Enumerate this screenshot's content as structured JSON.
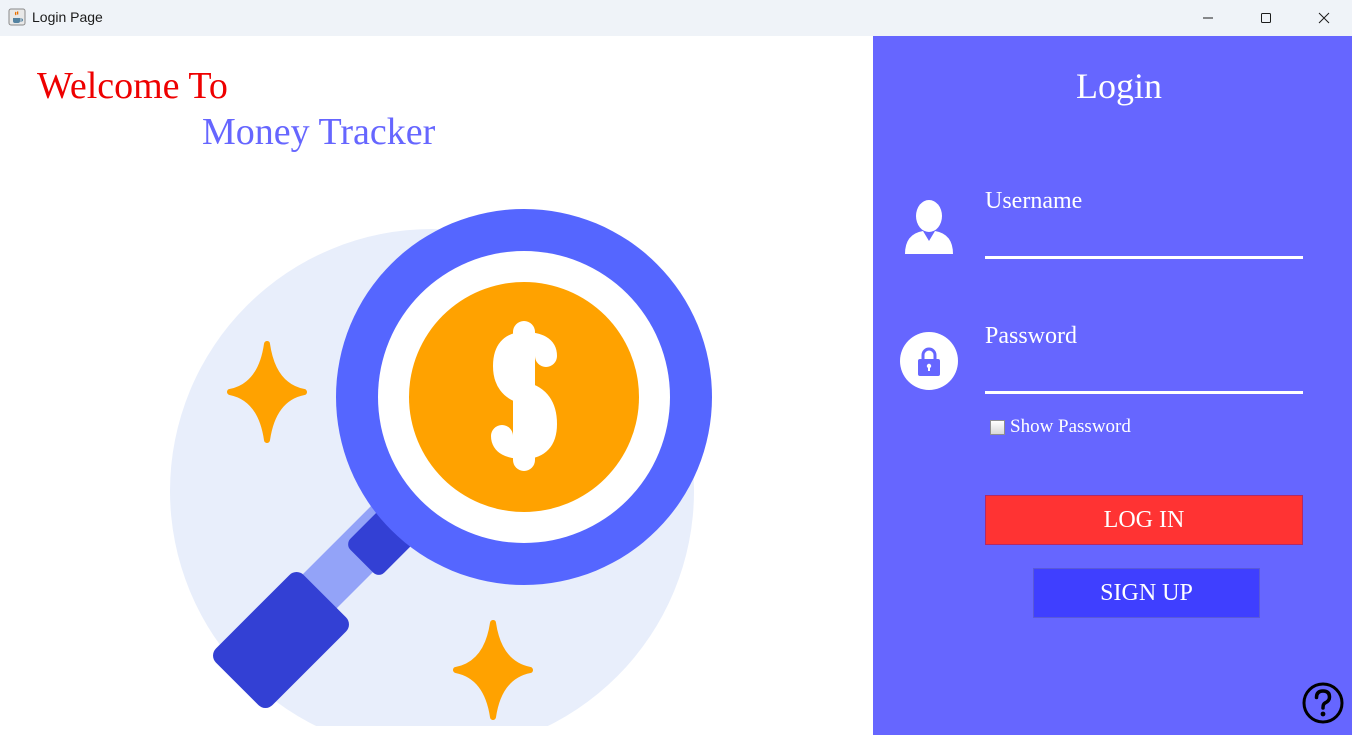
{
  "window": {
    "title": "Login Page",
    "icons": {
      "app": "java-cup-icon",
      "minimize": "minimize-icon",
      "maximize": "maximize-icon",
      "close": "close-icon"
    }
  },
  "welcome": {
    "line1": "Welcome To",
    "line2": "Money Tracker",
    "illustration_icon": "magnifier-dollar-icon"
  },
  "login": {
    "title": "Login",
    "username_label": "Username",
    "username_value": "",
    "password_label": "Password",
    "password_value": "",
    "show_password_label": "Show Password",
    "show_password_checked": false,
    "login_button": "LOG IN",
    "signup_button": "SIGN UP",
    "icons": {
      "user": "user-icon",
      "lock": "lock-icon",
      "help": "help-icon"
    }
  },
  "colors": {
    "panel": "#6666ff",
    "welcome_text": "#ee0000",
    "brand_text": "#6666ff",
    "login_button": "#ff3333",
    "signup_button": "#3f3fff",
    "coin": "#ffa200",
    "lens_ring": "#5566ff"
  }
}
